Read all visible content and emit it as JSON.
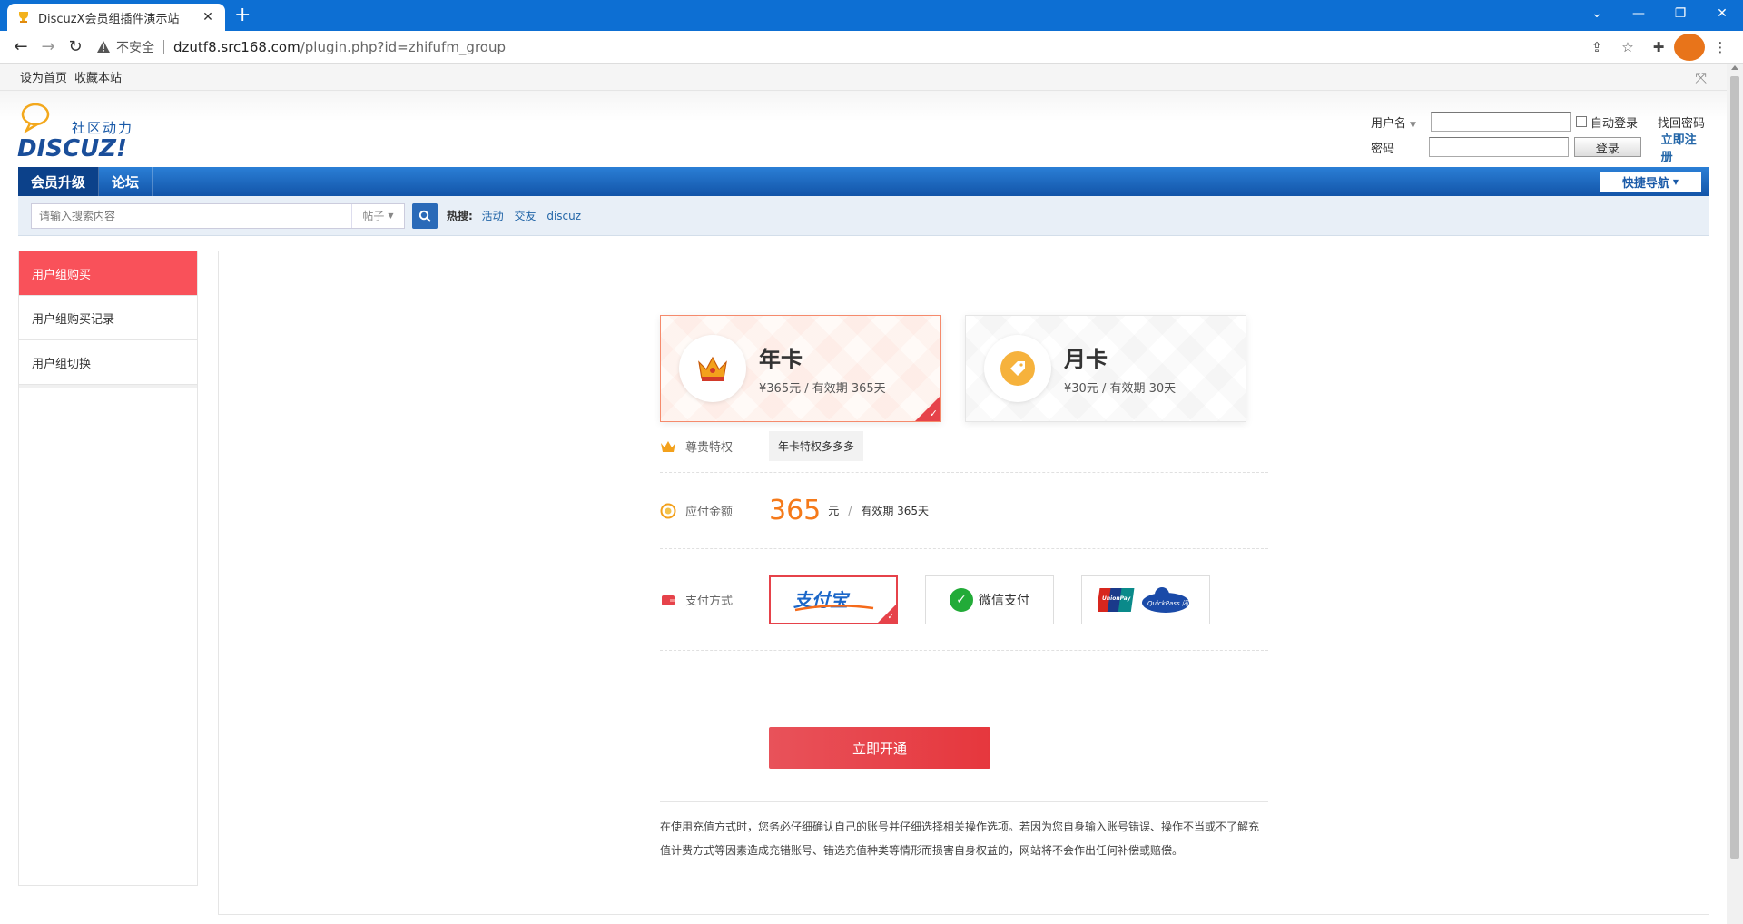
{
  "browser": {
    "tab_title": "DiscuzX会员组插件演示站",
    "new_tab": "+",
    "security_label": "不安全",
    "url_host": "dzutf8.src168.com",
    "url_path": "/plugin.php?id=zhifufm_group",
    "avatar_initial": "",
    "window_controls": [
      "⌄",
      "—",
      "❐",
      "✕"
    ]
  },
  "topstrip": {
    "set_home": "设为首页",
    "bookmark": "收藏本站"
  },
  "logo": {
    "text": "DISCUZ!",
    "tagline": "社区动力"
  },
  "login": {
    "username_label": "用户名",
    "password_label": "密码",
    "auto_login": "自动登录",
    "forgot": "找回密码",
    "login_button": "登录",
    "register": "立即注册"
  },
  "nav": {
    "items": [
      "会员升级",
      "论坛"
    ],
    "quick_nav": "快捷导航"
  },
  "search": {
    "placeholder": "请输入搜索内容",
    "type": "帖子",
    "hot_label": "热搜:",
    "hot_items": [
      "活动",
      "交友",
      "discuz"
    ]
  },
  "sidebar": {
    "items": [
      "用户组购买",
      "用户组购买记录",
      "用户组切换"
    ]
  },
  "plans": [
    {
      "title": "年卡",
      "desc": "¥365元 / 有效期 365天",
      "selected": true
    },
    {
      "title": "月卡",
      "desc": "¥30元 / 有效期 30天",
      "selected": false
    }
  ],
  "privilege": {
    "label": "尊贵特权",
    "value": "年卡特权多多多"
  },
  "amount": {
    "label": "应付金额",
    "price": "365",
    "unit": "元",
    "separator": "/",
    "validity": "有效期 365天"
  },
  "payment": {
    "label": "支付方式",
    "alipay": "支付宝",
    "wechat": "微信支付",
    "unionpay": "UnionPay 银联",
    "quickpass": "QuickPass 闪付"
  },
  "submit_label": "立即开通",
  "notice_lines": [
    "在使用充值方式时，您务必仔细确认自己的账号并仔细选择相关操作选项。若因为您自身输入账号错误、操作不当或不了解充",
    "值计费方式等因素造成充错账号、错选充值种类等情形而损害自身权益的，网站将不会作出任何补偿或赔偿。"
  ],
  "colors": {
    "brand_blue": "#1a5aa8",
    "accent_red": "#e6424a",
    "price_orange": "#f57a1a"
  }
}
